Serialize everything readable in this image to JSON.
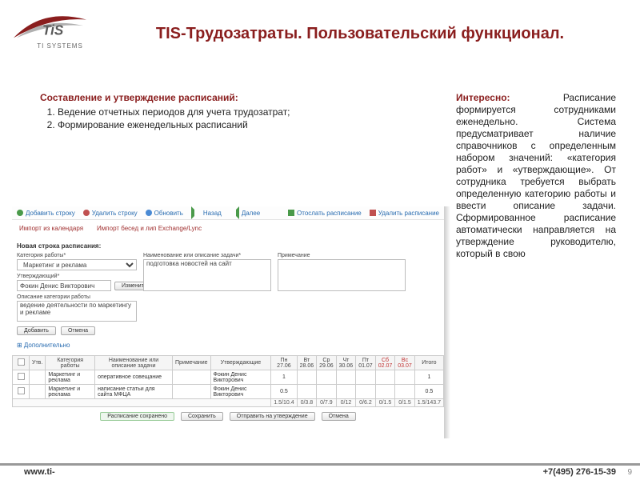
{
  "logo": {
    "caption": "TI SYSTEMS"
  },
  "title": "TIS-Трудозатраты. Пользовательский функционал.",
  "left": {
    "heading": "Составление и утверждение расписаний:",
    "items": [
      "Ведение отчетных периодов для учета трудозатрат;",
      "Формирование еженедельных расписаний"
    ]
  },
  "right": {
    "heading": "Интересно:",
    "body": "Расписание формируется сотрудниками еженедельно. Система предусматривает наличие справочников с определенным набором значений: «категория работ» и «утверждающие». От сотрудника требуется выбрать определенную категорию работы и ввести описание задачи. Сформированное расписание автоматически направляется на утверждение руководителю, который в свою"
  },
  "app": {
    "toolbar": {
      "add_row": "Добавить строку",
      "del_row": "Удалить строку",
      "refresh": "Обновить",
      "back": "Назад",
      "forward": "Далее",
      "send": "Отослать расписание",
      "delete": "Удалить расписание"
    },
    "imports": {
      "from_calendar": "Импорт из календаря",
      "from_lync": "Импорт бесед и лип Exchange/Lync"
    },
    "section_new_row": "Новая строка расписания:",
    "labels": {
      "category": "Категория работы*",
      "approver": "Утверждающий*",
      "activity": "Наименование или описание задачи*",
      "description": "Описание категории работы",
      "note": "Примечание"
    },
    "values": {
      "category": "Маркетинг и реклама",
      "approver": "Фокин Денис Викторович",
      "activity": "подготовка новостей на сайт",
      "description": "ведение деятельности по маркетингу и рекламе",
      "note": ""
    },
    "buttons": {
      "change": "Изменить",
      "add": "Добавить",
      "cancel": "Отмена",
      "additional": "⊞ Дополнительно",
      "save_schedule": "Расписание сохранено",
      "save": "Сохранить",
      "send_approve": "Отправить на утверждение"
    },
    "table": {
      "headers": {
        "check": "",
        "approve": "Утв.",
        "category": "Категория работы",
        "task": "Наименование или описание задачи",
        "note": "Примечание",
        "approver": "Утверждающие",
        "total": "Итого"
      },
      "days": [
        {
          "d": "Пн",
          "n": "27.06"
        },
        {
          "d": "Вт",
          "n": "28.06"
        },
        {
          "d": "Ср",
          "n": "29.06"
        },
        {
          "d": "Чт",
          "n": "30.06"
        },
        {
          "d": "Пт",
          "n": "01.07"
        },
        {
          "d": "Сб",
          "n": "02.07",
          "red": true
        },
        {
          "d": "Вс",
          "n": "03.07",
          "red": true
        }
      ],
      "rows": [
        {
          "category": "Маркетинг и реклама",
          "task": "оперативное совещание",
          "approver": "Фокин Денис Викторович",
          "cells": [
            "1",
            "",
            "",
            "",
            "",
            "",
            ""
          ],
          "total": "1"
        },
        {
          "category": "Маркетинг и реклама",
          "task": "написание статьи для сайта МФЦА",
          "approver": "Фокин Денис Викторович",
          "cells": [
            "0.5",
            "",
            "",
            "",
            "",
            "",
            ""
          ],
          "total": "0.5"
        }
      ],
      "footer": [
        "1.5/10.4",
        "0/3.8",
        "0/7.9",
        "0/12",
        "0/6.2",
        "0/1.5",
        "0/1.5",
        "1.5/143.7"
      ]
    }
  },
  "footer": {
    "site": "www.ti-",
    "phone": "+7(495) 276-15-39"
  },
  "page_number": "9"
}
